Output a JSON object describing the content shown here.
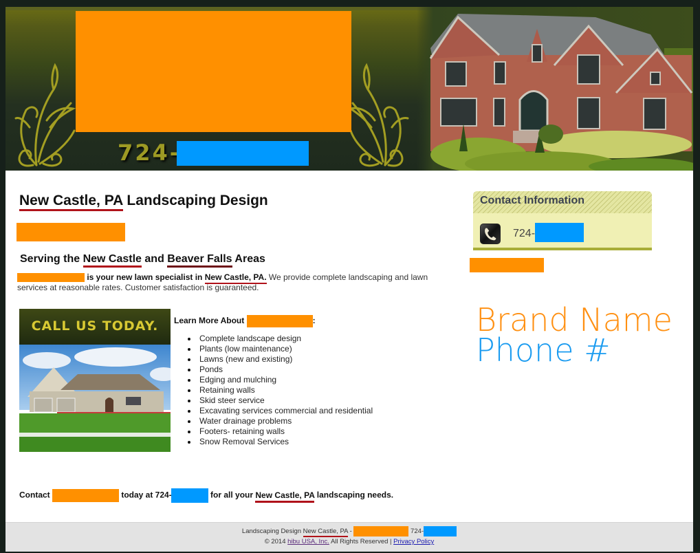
{
  "banner": {
    "phone_prefix": "724-",
    "colors": {
      "redact_orange": "#ff9000",
      "redact_blue": "#0099ff",
      "phone_gold": "#9d9a24"
    }
  },
  "main": {
    "title_location": "New Castle, PA",
    "title_rest": " Landscaping Design",
    "subtitle_prefix": "Serving the ",
    "subtitle_city1": "New Castle",
    "subtitle_and": " and ",
    "subtitle_city2": "Beaver Falls",
    "subtitle_suffix": " Areas",
    "intro_bold": " is your new lawn specialist in ",
    "intro_location": "New Castle, PA.",
    "intro_text": " We provide complete landscaping and lawn services at reasonable rates. Customer satisfaction is guaranteed.",
    "call_us_text": "CALL US TODAY.",
    "learn_more_prefix": "Learn More About ",
    "learn_more_suffix": ":",
    "services": [
      "Complete landscape design",
      "Plants (low maintenance)",
      "Lawns (new and existing)",
      "Ponds",
      "Edging and mulching",
      "Retaining walls",
      "Skid steer service",
      "Excavating services commercial and residential",
      "Water drainage problems",
      "Footers- retaining walls",
      "Snow Removal Services"
    ],
    "contact_prefix": "Contact ",
    "contact_middle": " today at 724-",
    "contact_for": " for all your ",
    "contact_location": "New Castle, PA",
    "contact_suffix": " landscaping needs."
  },
  "sidebar": {
    "contact_title": "Contact Information",
    "phone_prefix": "724-",
    "brand_name": "Brand Name",
    "brand_phone": "Phone #"
  },
  "footer": {
    "line1_prefix": "Landscaping Design ",
    "line1_location": "New Castle, PA",
    "line1_dash": " - ",
    "line1_phone_prefix": "724-",
    "copyright": "© 2014 ",
    "company_link": "hibu USA, Inc.",
    "rights": " All Rights Reserved | ",
    "privacy_link": "Privacy Policy"
  }
}
